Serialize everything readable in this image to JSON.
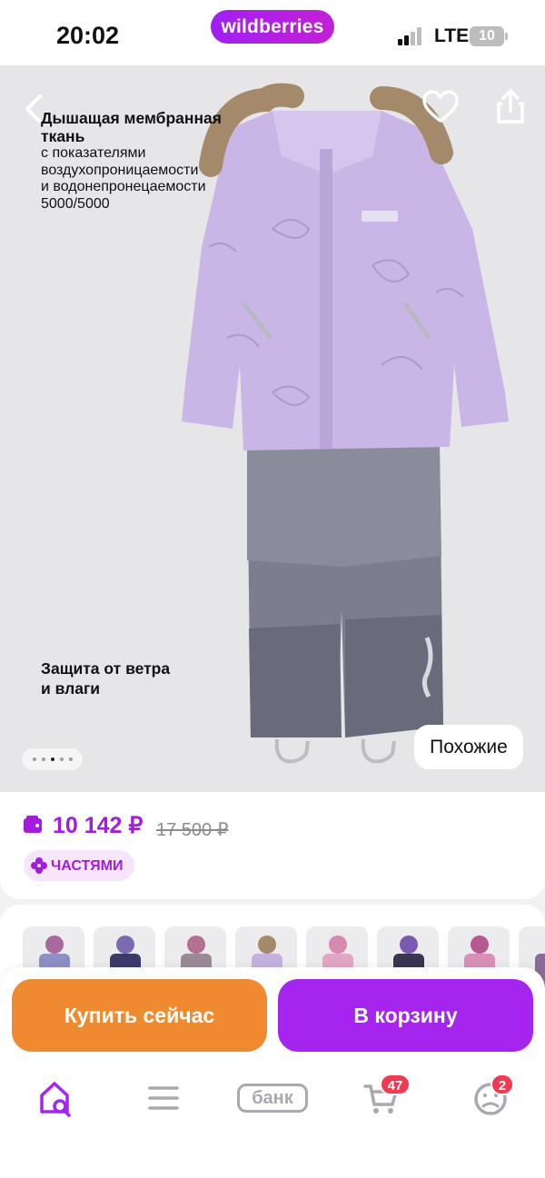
{
  "status_bar": {
    "time": "20:02",
    "brand": "wildberries",
    "network": "LTE",
    "battery": "10"
  },
  "gallery": {
    "caption_heading": "Дышащая мембранная ткань",
    "caption_lines": [
      "с показателями",
      "воздухопроницаемости",
      "и водонепронецаемости",
      "5000/5000"
    ],
    "caption2_line1": "Защита от ветра",
    "caption2_line2": "и влаги",
    "similar_label": "Похожие",
    "active_dot": 3,
    "dot_count": 5
  },
  "price": {
    "current": "10 142 ₽",
    "old": "17 500 ₽",
    "installment_label": "ЧАСТЯМИ"
  },
  "actions": {
    "buy_now": "Купить сейчас",
    "add_to_cart": "В корзину"
  },
  "nav": {
    "bank_label": "банк",
    "cart_badge": "47",
    "profile_badge": "2",
    "items": [
      "home-search-icon",
      "catalog-icon",
      "bank",
      "cart-icon",
      "profile-icon"
    ]
  },
  "colors": {
    "accent": "#a31cdb",
    "buy_now": "#f08a30",
    "to_cart": "#a524ee",
    "badge": "#ee3a53"
  }
}
